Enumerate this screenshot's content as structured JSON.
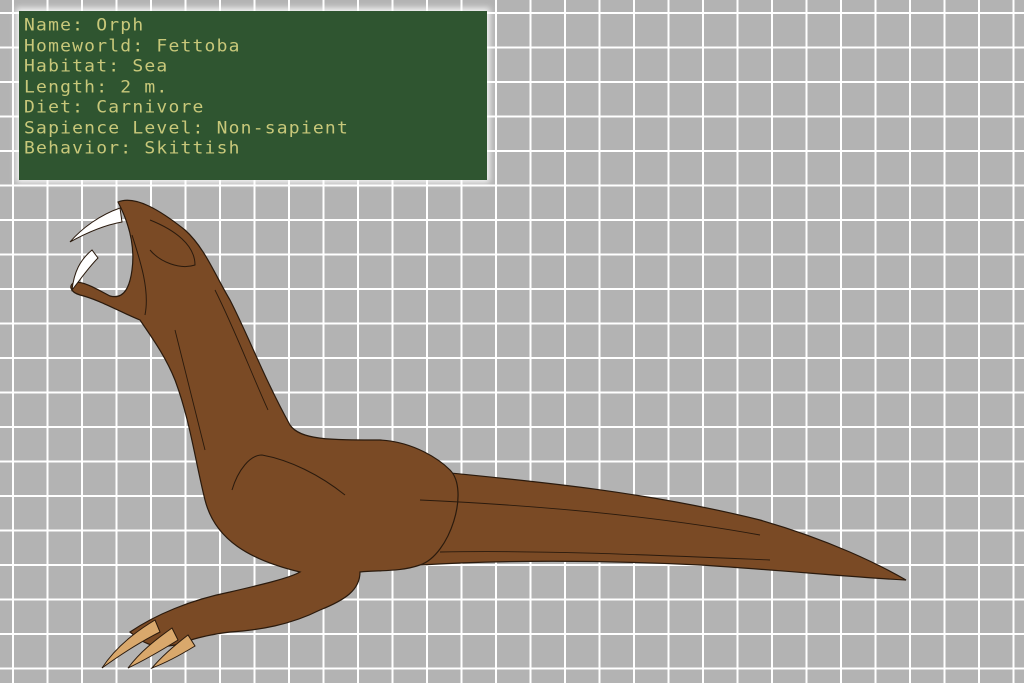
{
  "info": {
    "name": "Name: Orph",
    "homeworld": "Homeworld: Fettoba",
    "habitat": "Habitat: Sea",
    "length": "Length: 2 m.",
    "diet": "Diet: Carnivore",
    "sapience": "Sapience Level: Non-sapient",
    "behavior": "Behavior: Skittish"
  },
  "colors": {
    "background": "#b3b3b3",
    "grid_lines": "#ffffff",
    "panel": "#2f5530",
    "panel_text": "#c8c87a",
    "body": "#7a4a25",
    "claws": "#d9a86c",
    "teeth": "#ffffff"
  }
}
